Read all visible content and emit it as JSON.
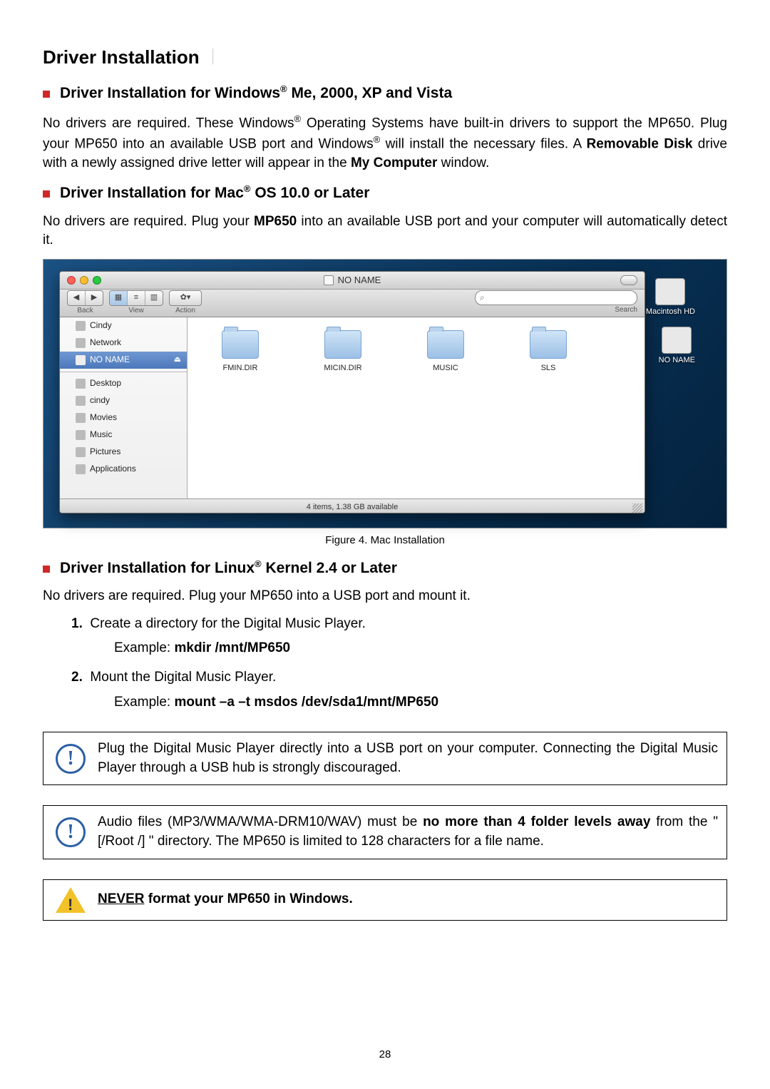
{
  "page_title": "Driver Installation",
  "sections": {
    "windows": {
      "title_pre": "Driver Installation for Windows",
      "sup": "®",
      "title_post": " Me, 2000, XP and Vista",
      "body_pre": "No drivers are required. These Windows",
      "body_mid": " Operating Systems have built-in drivers to support the MP650. Plug your MP650 into an available USB port and Windows",
      "body_post": " will install the necessary files. A ",
      "removable": "Removable Disk",
      "body_after_rd": " drive with a newly assigned drive letter will appear in the ",
      "mycomputer": "My Computer",
      "body_end": " window."
    },
    "mac": {
      "title_pre": "Driver Installation for Mac",
      "sup": "®",
      "title_post": " OS 10.0 or Later",
      "body_pre": "No drivers are required. Plug your ",
      "mp650": "MP650",
      "body_post": " into an available USB port and your computer will automatically detect it."
    },
    "linux": {
      "title_pre": "Driver Installation for Linux",
      "sup": "®",
      "title_post": " Kernel 2.4 or Later",
      "intro": "No drivers are required. Plug your MP650 into a USB port and mount it.",
      "step1_num": "1.",
      "step1": "Create a directory for the Digital Music Player.",
      "ex_label": "Example: ",
      "ex1_cmd": "mkdir /mnt/MP650",
      "step2_num": "2.",
      "step2": "Mount the Digital Music Player.",
      "ex2_cmd": "mount –a –t msdos /dev/sda1/mnt/MP650"
    }
  },
  "figure_caption": "Figure 4. Mac Installation",
  "finder": {
    "title": "NO NAME",
    "toolbar": {
      "back": "Back",
      "view": "View",
      "action": "Action",
      "search": "Search"
    },
    "search_placeholder": "",
    "sidebar": {
      "items_top": [
        "Cindy",
        "Network",
        "NO NAME"
      ],
      "items_bottom": [
        "Desktop",
        "cindy",
        "Movies",
        "Music",
        "Pictures",
        "Applications"
      ]
    },
    "folders": [
      "FMIN.DIR",
      "MICIN.DIR",
      "MUSIC",
      "SLS"
    ],
    "status": "4 items, 1.38 GB available",
    "desktop_icons": [
      "Macintosh HD",
      "NO NAME"
    ]
  },
  "warnings": {
    "usb": {
      "text_a": "Plug the Digital Music Player directly into a USB port on your computer. Connecting the Digital Music Player through a USB hub is strongly discouraged."
    },
    "folders": {
      "pre": "Audio files (MP3/WMA/WMA-DRM10/WAV) must be ",
      "bold": "no more than 4 folder levels away",
      "post": " from the \"[/Root /] \" directory. The MP650 is limited to 128 characters for a file name."
    },
    "never": {
      "never": "NEVER",
      "rest": " format your MP650 in Windows."
    }
  },
  "page_number": "28",
  "search_glyph": "⌕"
}
